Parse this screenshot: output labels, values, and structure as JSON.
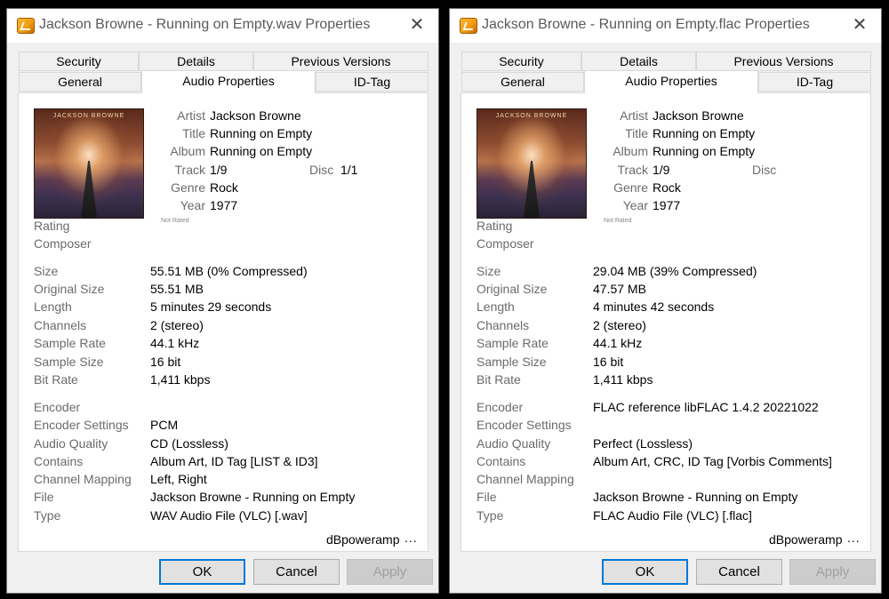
{
  "dialogs": [
    {
      "title": "Jackson Browne - Running on Empty.wav Properties",
      "tabs": {
        "row1": [
          "Security",
          "Details",
          "Previous Versions"
        ],
        "row2": [
          "General",
          "Audio Properties",
          "ID-Tag"
        ],
        "active": "Audio Properties"
      },
      "album_art_caption": "JACKSON BROWNE",
      "tag": {
        "artist_label": "Artist",
        "artist": "Jackson Browne",
        "title_label": "Title",
        "title": "Running on Empty",
        "album_label": "Album",
        "album": "Running on Empty",
        "track_label": "Track",
        "track": "1/9",
        "disc_label": "Disc",
        "disc": "1/1",
        "genre_label": "Genre",
        "genre": "Rock",
        "year_label": "Year",
        "year": "1977",
        "not_rated": "Not Rated"
      },
      "rating_label": "Rating",
      "composer_label": "Composer",
      "props": [
        {
          "label": "Size",
          "value": "55.51 MB  (0% Compressed)"
        },
        {
          "label": "Original Size",
          "value": "55.51 MB"
        },
        {
          "label": "Length",
          "value": "5 minutes 29 seconds"
        },
        {
          "label": "Channels",
          "value": "2  (stereo)"
        },
        {
          "label": "Sample Rate",
          "value": "44.1 kHz"
        },
        {
          "label": "Sample Size",
          "value": "16 bit"
        },
        {
          "label": "Bit Rate",
          "value": "1,411 kbps"
        }
      ],
      "encoding": [
        {
          "label": "Encoder",
          "value": ""
        },
        {
          "label": "Encoder Settings",
          "value": "PCM"
        },
        {
          "label": "Audio Quality",
          "value": "CD  (Lossless)"
        },
        {
          "label": "Contains",
          "value": "Album Art, ID Tag [LIST & ID3]"
        },
        {
          "label": "Channel Mapping",
          "value": "Left, Right"
        },
        {
          "label": "File",
          "value": "Jackson Browne - Running on Empty"
        },
        {
          "label": "Type",
          "value": "WAV Audio File (VLC)     [.wav]"
        }
      ],
      "brand": "dBpoweramp",
      "more": "...",
      "buttons": {
        "ok": "OK",
        "cancel": "Cancel",
        "apply": "Apply"
      }
    },
    {
      "title": "Jackson Browne - Running on Empty.flac Properties",
      "tabs": {
        "row1": [
          "Security",
          "Details",
          "Previous Versions"
        ],
        "row2": [
          "General",
          "Audio Properties",
          "ID-Tag"
        ],
        "active": "Audio Properties"
      },
      "album_art_caption": "JACKSON BROWNE",
      "tag": {
        "artist_label": "Artist",
        "artist": "Jackson Browne",
        "title_label": "Title",
        "title": "Running on Empty",
        "album_label": "Album",
        "album": "Running on Empty",
        "track_label": "Track",
        "track": "1/9",
        "disc_label": "Disc",
        "disc": "",
        "genre_label": "Genre",
        "genre": "Rock",
        "year_label": "Year",
        "year": "1977",
        "not_rated": "Not Rated"
      },
      "rating_label": "Rating",
      "composer_label": "Composer",
      "props": [
        {
          "label": "Size",
          "value": "29.04 MB  (39% Compressed)"
        },
        {
          "label": "Original Size",
          "value": "47.57 MB"
        },
        {
          "label": "Length",
          "value": "4 minutes 42 seconds"
        },
        {
          "label": "Channels",
          "value": "2  (stereo)"
        },
        {
          "label": "Sample Rate",
          "value": "44.1 kHz"
        },
        {
          "label": "Sample Size",
          "value": "16 bit"
        },
        {
          "label": "Bit Rate",
          "value": "1,411 kbps"
        }
      ],
      "encoding": [
        {
          "label": "Encoder",
          "value": "FLAC reference libFLAC 1.4.2 20221022"
        },
        {
          "label": "Encoder Settings",
          "value": ""
        },
        {
          "label": "Audio Quality",
          "value": "Perfect (Lossless)"
        },
        {
          "label": "Contains",
          "value": "Album Art, CRC, ID Tag [Vorbis Comments]"
        },
        {
          "label": "Channel Mapping",
          "value": ""
        },
        {
          "label": "File",
          "value": "Jackson Browne - Running on Empty"
        },
        {
          "label": "Type",
          "value": "FLAC Audio File (VLC)     [.flac]"
        }
      ],
      "brand": "dBpoweramp",
      "more": "...",
      "buttons": {
        "ok": "OK",
        "cancel": "Cancel",
        "apply": "Apply"
      }
    }
  ]
}
